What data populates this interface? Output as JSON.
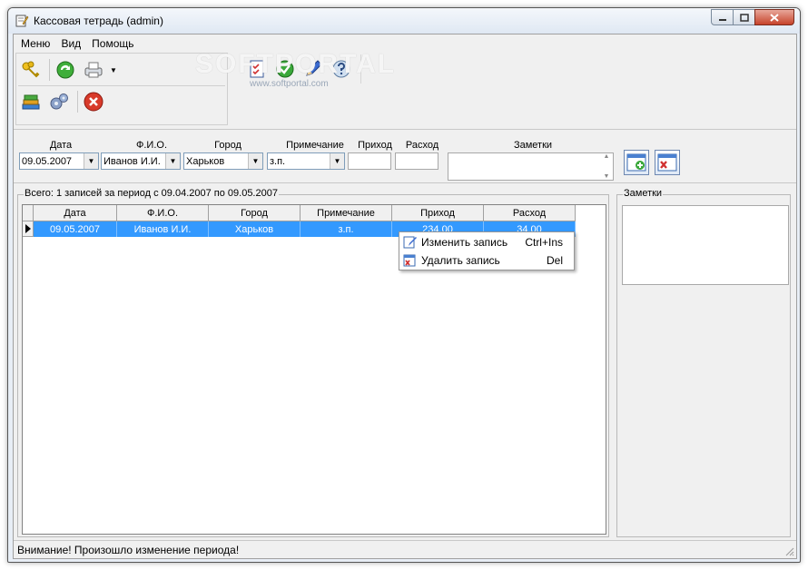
{
  "window": {
    "title": "Кассовая тетрадь (admin)"
  },
  "menu": [
    {
      "label": "Меню"
    },
    {
      "label": "Вид"
    },
    {
      "label": "Помощь"
    }
  ],
  "watermark": {
    "main": "SOFTPORTAL",
    "sub": "www.softportal.com"
  },
  "toolbar": {
    "icons": [
      "keys-icon",
      "refresh-icon",
      "printer-icon",
      "books-icon",
      "gears-icon",
      "stop-icon"
    ],
    "secondary_icons": [
      "checklist-icon",
      "check-circle-icon",
      "edit-pen-icon",
      "help-icon"
    ]
  },
  "filter": {
    "labels": {
      "date": "Дата",
      "name": "Ф.И.О.",
      "city": "Город",
      "note": "Примечание",
      "income": "Приход",
      "expense": "Расход",
      "memo": "Заметки"
    },
    "values": {
      "date": "09.05.2007",
      "name": "Иванов И.И.",
      "city": "Харьков",
      "note": "з.п.",
      "income": "",
      "expense": "",
      "memo": ""
    }
  },
  "records": {
    "summary": "Всего: 1 записей за период с 09.04.2007 по 09.05.2007",
    "columns": [
      "Дата",
      "Ф.И.О.",
      "Город",
      "Примечание",
      "Приход",
      "Расход"
    ],
    "rows": [
      {
        "date": "09.05.2007",
        "name": "Иванов И.И.",
        "city": "Харьков",
        "note": "з.п.",
        "income": "234.00",
        "expense": "34.00"
      }
    ]
  },
  "notes_panel": {
    "title": "Заметки"
  },
  "context_menu": [
    {
      "label": "Изменить запись",
      "shortcut": "Ctrl+Ins"
    },
    {
      "label": "Удалить запись",
      "shortcut": "Del"
    }
  ],
  "status": {
    "text": "Внимание! Произошло изменение периода!"
  },
  "colors": {
    "selection": "#3399ff",
    "titlebar": "#dfe8f3",
    "close": "#c7432a"
  }
}
